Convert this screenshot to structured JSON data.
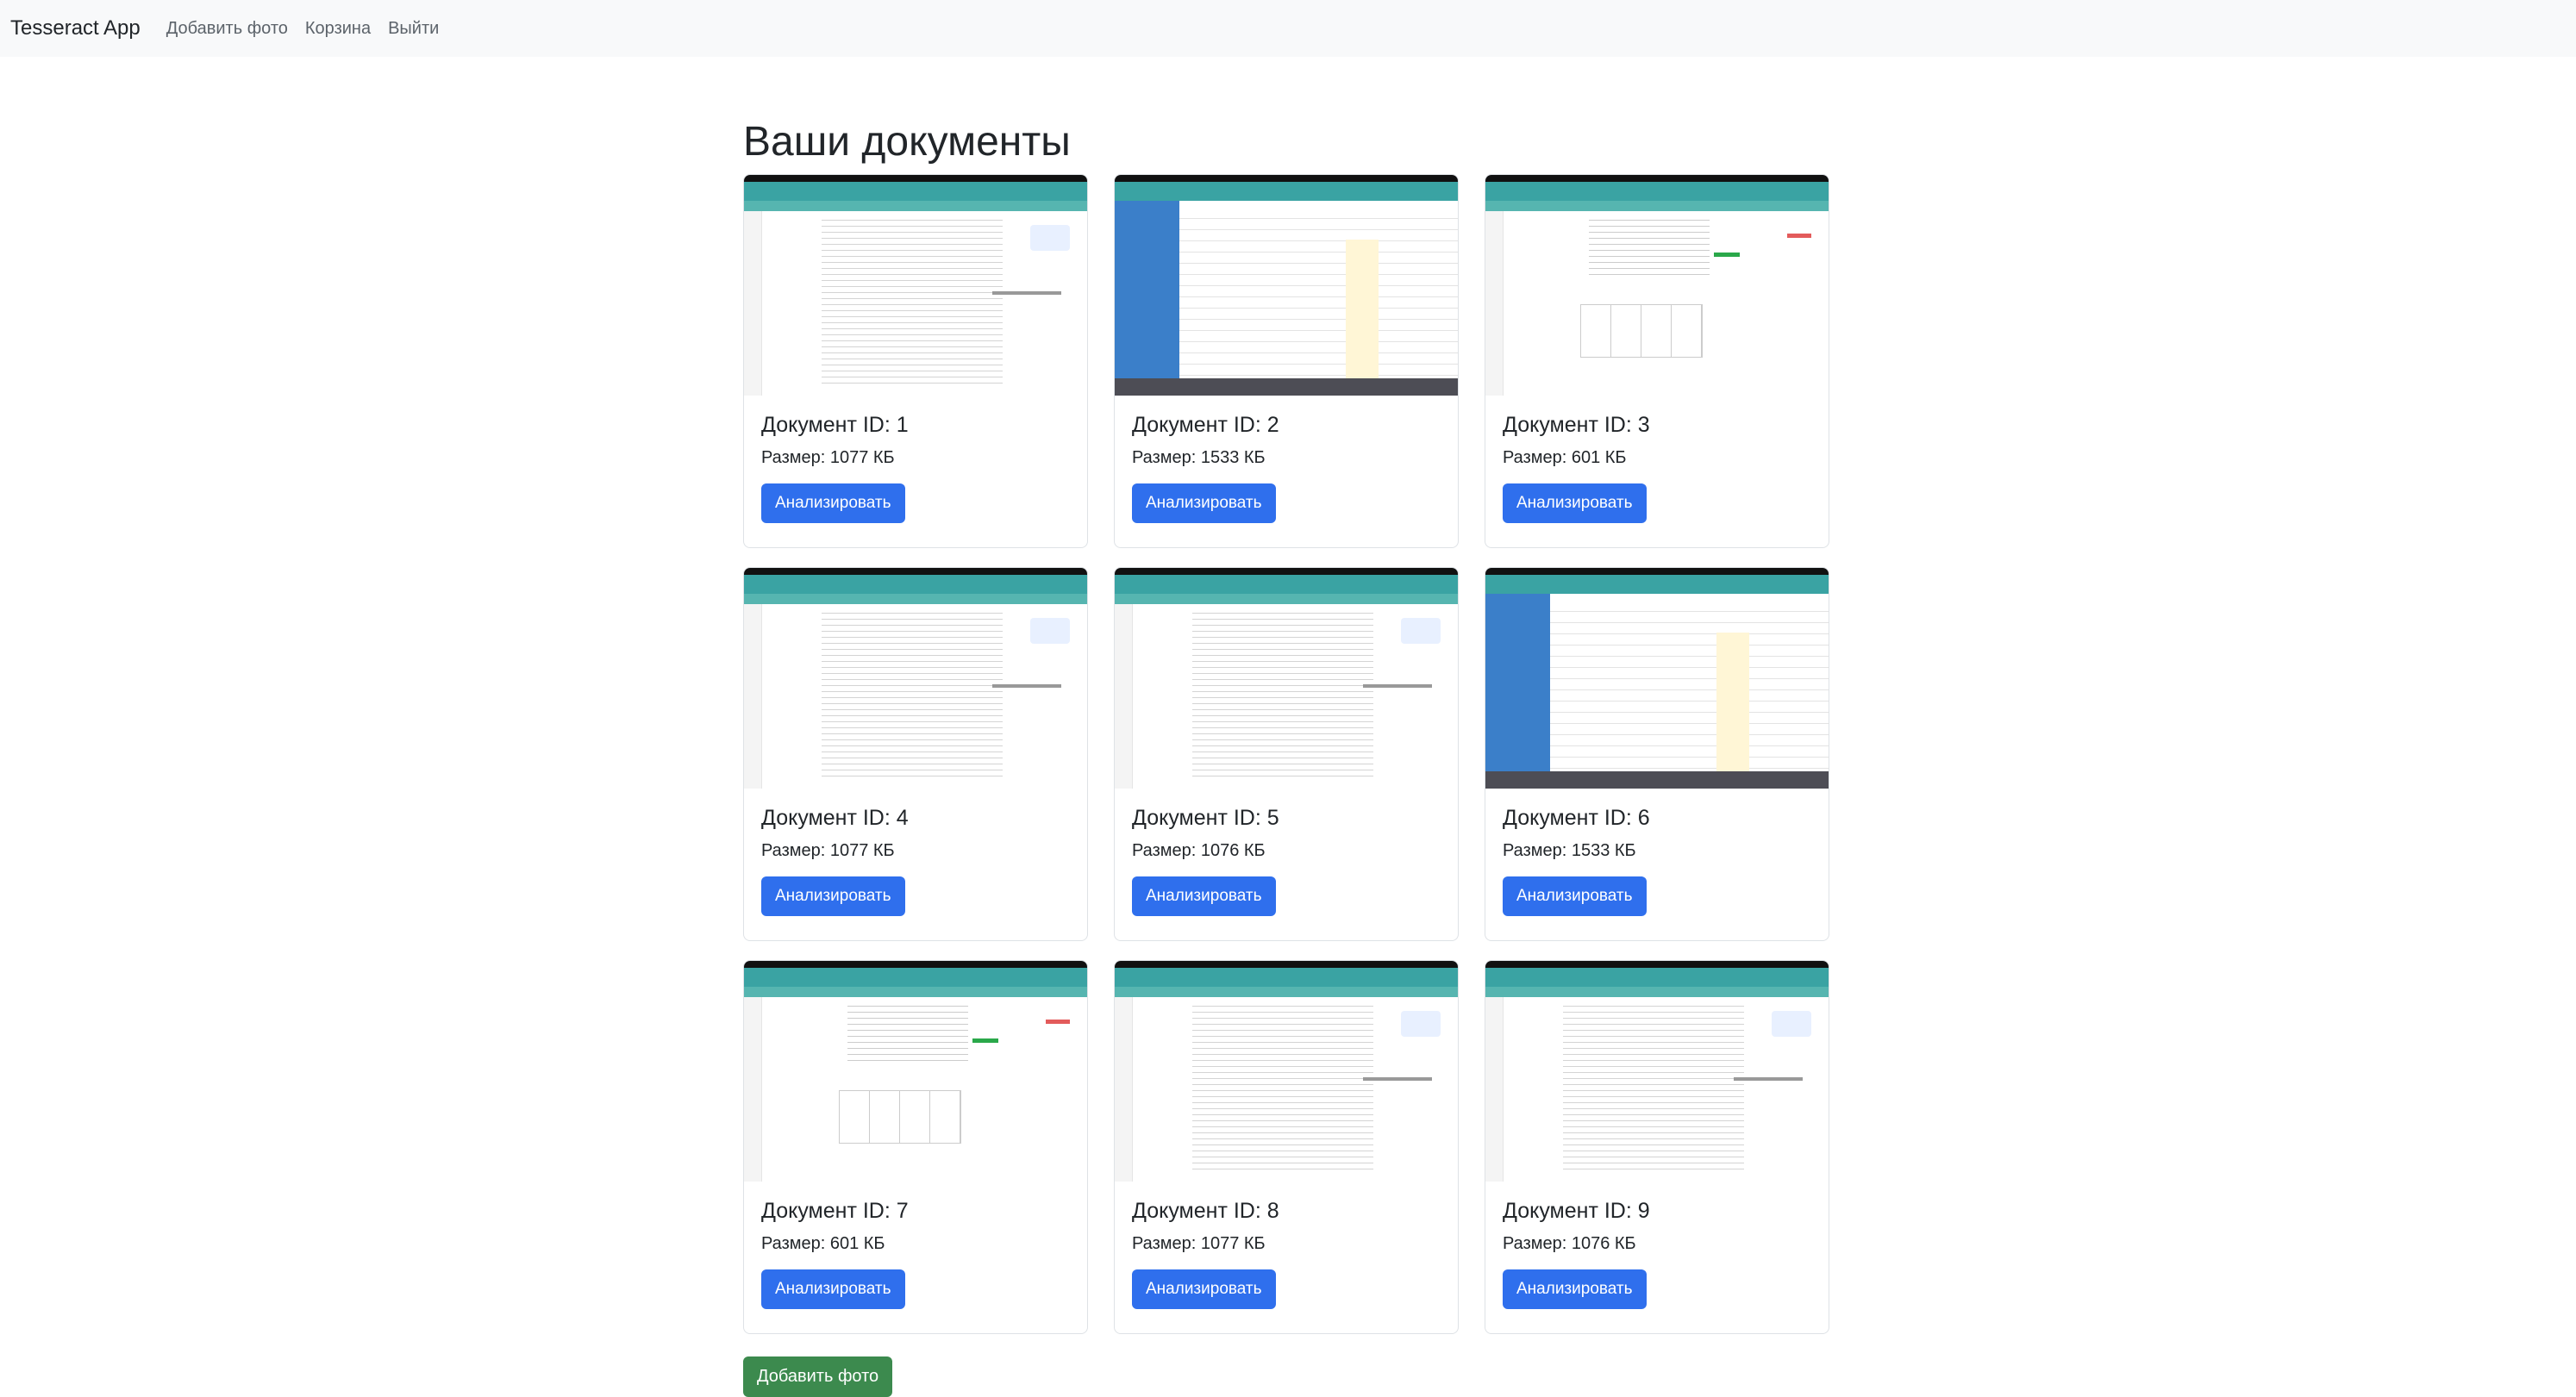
{
  "navbar": {
    "brand": "Tesseract App",
    "links": [
      "Добавить фото",
      "Корзина",
      "Выйти"
    ]
  },
  "main": {
    "title": "Ваши документы",
    "add_button": "Добавить фото",
    "documents": [
      {
        "title": "Документ ID: 1",
        "size": "Размер: 1077 КБ",
        "button": "Анализировать",
        "preview": "math-notes"
      },
      {
        "title": "Документ ID: 2",
        "size": "Размер: 1533 КБ",
        "button": "Анализировать",
        "preview": "schedule"
      },
      {
        "title": "Документ ID: 3",
        "size": "Размер: 601 КБ",
        "button": "Анализировать",
        "preview": "whiteboard-table"
      },
      {
        "title": "Документ ID: 4",
        "size": "Размер: 1077 КБ",
        "button": "Анализировать",
        "preview": "math-notes"
      },
      {
        "title": "Документ ID: 5",
        "size": "Размер: 1076 КБ",
        "button": "Анализировать",
        "preview": "math-notes"
      },
      {
        "title": "Документ ID: 6",
        "size": "Размер: 1533 КБ",
        "button": "Анализировать",
        "preview": "schedule"
      },
      {
        "title": "Документ ID: 7",
        "size": "Размер: 601 КБ",
        "button": "Анализировать",
        "preview": "whiteboard-table"
      },
      {
        "title": "Документ ID: 8",
        "size": "Размер: 1077 КБ",
        "button": "Анализировать",
        "preview": "math-notes"
      },
      {
        "title": "Документ ID: 9",
        "size": "Размер: 1076 КБ",
        "button": "Анализировать",
        "preview": "math-notes"
      }
    ]
  },
  "colors": {
    "primary": "#2f6fed",
    "success": "#3c8a4e",
    "navbar_bg": "#f8f9fa"
  }
}
